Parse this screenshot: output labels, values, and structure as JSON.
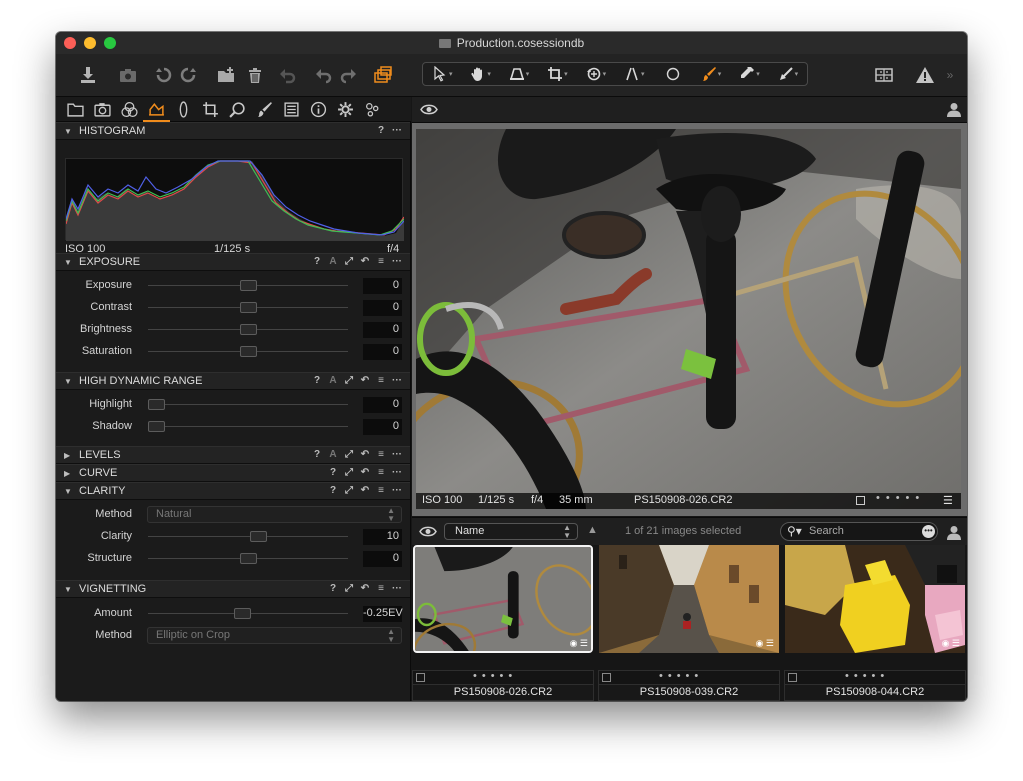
{
  "window": {
    "title": "Production.cosessiondb"
  },
  "toolbar": {
    "left_icons": [
      "import-icon",
      "camera-icon",
      "undo-icon",
      "redo-icon",
      "new-folder-icon",
      "trash-icon",
      "rotate-left-icon",
      "rotate-ccw-icon",
      "rotate-cw-icon",
      "stack-icon"
    ],
    "cursor_tools": [
      "select-cursor-icon",
      "pan-hand-icon",
      "keystone-icon",
      "crop-icon",
      "rotate-tool-icon",
      "straighten-icon",
      "spot-removal-icon",
      "brush-icon",
      "picker-icon",
      "apply-adjustments-icon"
    ],
    "right_icons": [
      "grid-layout-icon",
      "warning-icon"
    ]
  },
  "tool_tabs": [
    "library-tab",
    "capture-tab",
    "color-tab",
    "exposure-tab",
    "lens-tab",
    "composition-tab",
    "details-tab",
    "local-adjustments-tab",
    "metadata-tab",
    "output-tab",
    "batch-tab",
    "quick-tab"
  ],
  "accent_color": "#f08c1c",
  "histogram": {
    "title": "HISTOGRAM",
    "iso": "ISO 100",
    "shutter": "1/125 s",
    "aperture": "f/4"
  },
  "exposure": {
    "title": "EXPOSURE",
    "rows": [
      {
        "label": "Exposure",
        "value": "0",
        "level": 0.5
      },
      {
        "label": "Contrast",
        "value": "0",
        "level": 0.5
      },
      {
        "label": "Brightness",
        "value": "0",
        "level": 0.5
      },
      {
        "label": "Saturation",
        "value": "0",
        "level": 0.5
      }
    ]
  },
  "hdr": {
    "title": "HIGH DYNAMIC RANGE",
    "rows": [
      {
        "label": "Highlight",
        "value": "0",
        "level": 0
      },
      {
        "label": "Shadow",
        "value": "0",
        "level": 0
      }
    ]
  },
  "levels": {
    "title": "LEVELS"
  },
  "curve": {
    "title": "CURVE"
  },
  "clarity": {
    "title": "CLARITY",
    "method_label": "Method",
    "method_value": "Natural",
    "rows": [
      {
        "label": "Clarity",
        "value": "10",
        "level": 0.55
      },
      {
        "label": "Structure",
        "value": "0",
        "level": 0.5
      }
    ]
  },
  "vignetting": {
    "title": "VIGNETTING",
    "amount_label": "Amount",
    "amount_value": "-0.25EV",
    "amount_level": 0.47,
    "method_label": "Method",
    "method_value": "Elliptic on Crop"
  },
  "viewer": {
    "iso": "ISO 100",
    "shutter": "1/125 s",
    "aperture": "f/4",
    "focal": "35 mm",
    "filename": "PS150908-026.CR2"
  },
  "browser": {
    "sort_value": "Name",
    "selection_text": "1 of 21 images selected",
    "search_placeholder": "Search",
    "thumbs": [
      {
        "filename": "PS150908-026.CR2",
        "selected": true
      },
      {
        "filename": "PS150908-039.CR2",
        "selected": false
      },
      {
        "filename": "PS150908-044.CR2",
        "selected": false
      }
    ]
  }
}
